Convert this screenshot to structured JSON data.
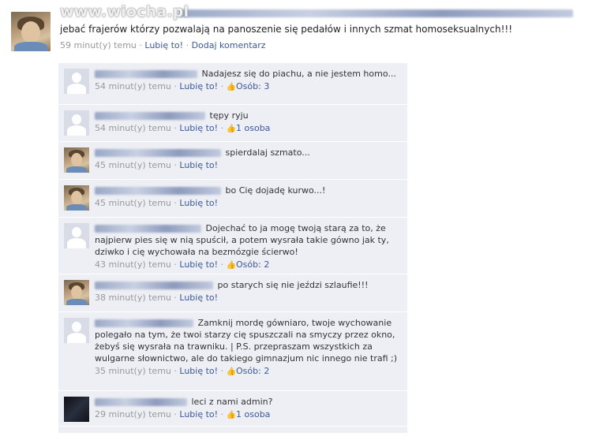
{
  "watermark": "www.wiocha.pl",
  "post": {
    "text": "jebać frajerów którzy pozwalają na panoszenie się pedałów i innych szmat homoseksualnych!!!",
    "time": "59 minut(y) temu",
    "like": "Lubię to!",
    "comment": "Dodaj komentarz",
    "sep": "·"
  },
  "comments": [
    {
      "text": "Nadajesz się do piachu, a nie jestem homo...",
      "time": "54 minut(y) temu",
      "like": "Lubię to!",
      "count": "Osób: 3",
      "sep": "·"
    },
    {
      "text": "tępy ryju",
      "time": "54 minut(y) temu",
      "like": "Lubię to!",
      "count": "1 osoba",
      "sep": "·"
    },
    {
      "text": "spierdalaj szmato...",
      "time": "45 minut(y) temu",
      "like": "Lubię to!",
      "sep": "·"
    },
    {
      "text": "bo Cię dojadę kurwo...!",
      "time": "45 minut(y) temu",
      "like": "Lubię to!",
      "sep": "·"
    },
    {
      "text": "Dojechać to ja mogę twoją starą za to, że najpierw pies się w nią spuścił, a potem wysrała takie gówno jak ty, dziwko i cię wychowała na bezmózgie ścierwo!",
      "time": "43 minut(y) temu",
      "like": "Lubię to!",
      "count": "Osób: 2",
      "sep": "·"
    },
    {
      "text": "po starych się nie jeździ szlaufie!!!",
      "time": "38 minut(y) temu",
      "like": "Lubię to!",
      "sep": "·"
    },
    {
      "text": "Zamknij mordę gówniaro, twoje wychowanie polegało na tym, że twoi starzy cię spuszczali na smyczy przez okno, żebyś się wysrała na trawniku. | P.S. przepraszam wszystkich za wulgarne słownictwo, ale do takiego gimnazjum nic innego nie trafi ;)",
      "time": "35 minut(y) temu",
      "like": "Lubię to!",
      "count": "Osób: 2",
      "sep": "·"
    },
    {
      "text": "leci z nami admin?",
      "time": "29 minut(y) temu",
      "like": "Lubię to!",
      "count": "1 osoba",
      "sep": "·"
    }
  ],
  "icons": {
    "thumb": "thumbs-up-icon",
    "thumb_glyph": "👍"
  },
  "colors": {
    "link": "#3b5998",
    "comment_bg": "#edeff4",
    "meta": "#999999"
  }
}
